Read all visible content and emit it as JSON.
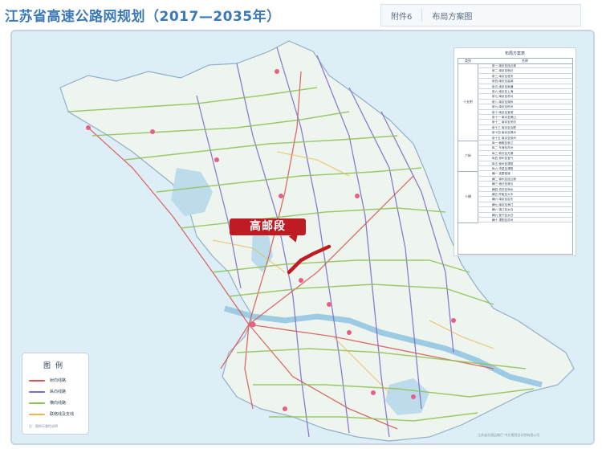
{
  "header": {
    "title": "江苏省高速公路网规划（2017—2035年）",
    "tag_1": "附件6",
    "tag_2": "布局方案图"
  },
  "callout": {
    "label": "高邮段",
    "color": "#bf1b22"
  },
  "layout_table": {
    "title": "布局方案表",
    "col_1": "类别",
    "col_2": "名称",
    "group_1": "十五射",
    "group_2": "六纵",
    "group_3": "十横",
    "rows": [
      "射一 南京至连云港",
      "射二 南京至宿迁",
      "射三 南京至淮安",
      "射四 南京至盐城",
      "射五 南京至南通",
      "射六 南京至上海",
      "射七 南京至苏州",
      "射八 南京至湖州",
      "射九 南京至杭州",
      "射十 南京至宣城",
      "射十一 南京至黄山",
      "射十二 南京至安庆",
      "射十三 南京至合肥",
      "射十四 南京至滁州",
      "射十五 南京至徐州",
      "纵一 赣榆至吴江",
      "纵二 东海至苏州",
      "纵三 新沂至无锡",
      "纵四 邳州至宜兴",
      "纵五 徐州至溧阳",
      "纵六 沛县至溧阳",
      "横一 连霍高速",
      "横二 徐州至连云港",
      "横三 宿迁至灌云",
      "横四 泗洪至响水",
      "横五 盱眙至大丰",
      "横六 南京至启东",
      "横七 南京至海门",
      "横八 镇江至太仓",
      "横九 宜兴至太仓",
      "横十 溧阳至苏州"
    ]
  },
  "legend": {
    "title": "图例",
    "items": [
      {
        "label": "射向线路",
        "color": "#d9534f"
      },
      {
        "label": "纵向线路",
        "color": "#7b68c9"
      },
      {
        "label": "横向线路",
        "color": "#8cc152"
      },
      {
        "label": "联络线及支线",
        "color": "#e8b84a"
      }
    ],
    "note": "注：图例示意性说明"
  },
  "footer": "江苏省交通运输厅  中交规划设计院有限公司",
  "colors": {
    "land": "#e9f1ec",
    "water": "#bcdcec",
    "sea": "#d6ecf5",
    "highlight": "#bf1b22"
  }
}
